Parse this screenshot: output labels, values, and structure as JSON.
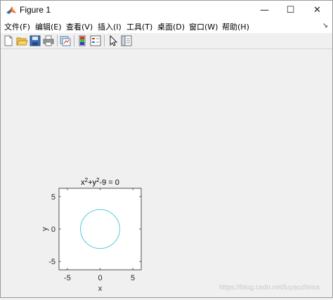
{
  "window": {
    "title": "Figure 1"
  },
  "window_controls": {
    "minimize": "—",
    "maximize": "☐",
    "close": "✕"
  },
  "menu": {
    "items": [
      "文件(F)",
      "编辑(E)",
      "查看(V)",
      "插入(I)",
      "工具(T)",
      "桌面(D)",
      "窗口(W)",
      "帮助(H)"
    ],
    "dock_arrow": "↘"
  },
  "toolbar": {
    "icons": [
      "new-figure-icon",
      "open-file-icon",
      "save-icon",
      "print-icon",
      "link-plot-icon",
      "insert-colorbar-icon",
      "insert-legend-icon",
      "pointer-icon",
      "property-inspector-icon"
    ]
  },
  "plot": {
    "title_base": "x",
    "title_sup1": "2",
    "title_mid": "+y",
    "title_sup2": "2",
    "title_end": "-9 = 0",
    "xlabel": "x",
    "ylabel": "y",
    "line_color": "#3ec6d8"
  },
  "chart_data": {
    "type": "line",
    "title": "x^2+y^2-9 = 0",
    "xlabel": "x",
    "ylabel": "y",
    "xlim": [
      -6.28,
      6.28
    ],
    "ylim": [
      -6.28,
      6.28
    ],
    "xticks": [
      -5,
      0,
      5
    ],
    "yticks": [
      -5,
      0,
      5
    ],
    "grid": false,
    "series": [
      {
        "shape": "circle",
        "center": [
          0,
          0
        ],
        "radius": 3
      }
    ]
  },
  "watermark": "https://blog.csdn.net/luyaozhima"
}
